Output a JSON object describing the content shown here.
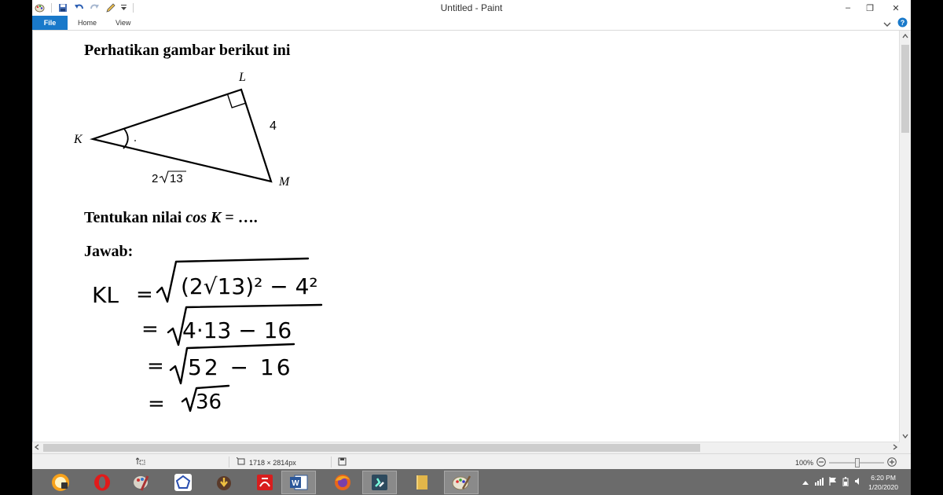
{
  "window": {
    "title": "Untitled - Paint",
    "controls": {
      "minimize": "‒",
      "maximize": "❐",
      "close": "✕"
    }
  },
  "quick_access": [
    "paint-app-icon",
    "save-icon",
    "undo-icon",
    "redo-icon",
    "pencil-icon",
    "customize-icon"
  ],
  "tabs": {
    "file": "File",
    "home": "Home",
    "view": "View"
  },
  "document": {
    "heading": "Perhatikan gambar berikut ini",
    "triangle": {
      "vertex_l": "L",
      "vertex_k": "K",
      "vertex_m": "M",
      "side_lm": "4",
      "side_km_coef": "2",
      "side_km_radicand": "13"
    },
    "question_prefix": "Tentukan nilai ",
    "question_expr": "cos K",
    "question_suffix": " = ….",
    "answer_label": "Jawab:",
    "handwriting": {
      "line1_lhs": "KL",
      "line1_eq": "=",
      "line1_expr": "(2√13)² − 4²",
      "line2_eq": "=",
      "line2_expr": "4·13 − 16",
      "line3_eq": "=",
      "line3_expr": "52 − 16",
      "line4_eq": "=",
      "line4_expr": "36"
    }
  },
  "status": {
    "dimensions": "1718 × 2814px",
    "zoom": "100%"
  },
  "taskbar": {
    "apps": [
      "start-orb-icon",
      "opera-icon",
      "paint-brush-app-icon",
      "polygon-app-icon",
      "download-app-icon",
      "pdf-reader-icon",
      "word-icon",
      "firefox-icon",
      "media-app-icon",
      "folder-icon",
      "paint-icon"
    ],
    "time": "6:20 PM",
    "date": "1/20/2020"
  }
}
